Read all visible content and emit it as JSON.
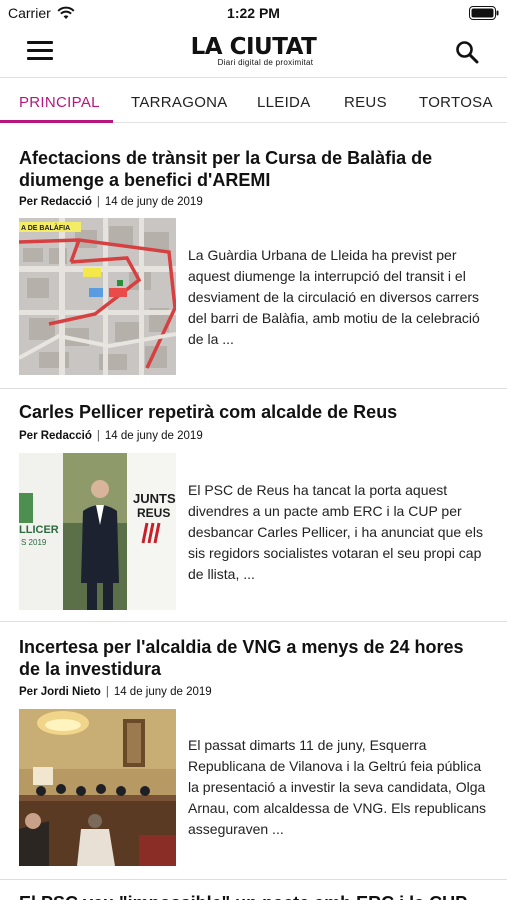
{
  "status_bar": {
    "carrier": "Carrier",
    "time": "1:22 PM",
    "icons": [
      "wifi-icon",
      "battery-icon"
    ]
  },
  "header": {
    "logo_title": "LA CIUTAT",
    "logo_subtitle": "Diari digital de proximitat",
    "icons": [
      "menu-icon",
      "search-icon"
    ]
  },
  "tabs": [
    {
      "label": "PRINCIPAL",
      "active": true
    },
    {
      "label": "TARRAGONA",
      "active": false
    },
    {
      "label": "LLEIDA",
      "active": false
    },
    {
      "label": "REUS",
      "active": false
    },
    {
      "label": "TORTOSA",
      "active": false
    }
  ],
  "colors": {
    "accent": "#b5177e",
    "text": "#111111",
    "divider": "#dedede"
  },
  "articles": [
    {
      "title": "Afectacions de trànsit per la Cursa de Balàfia de diumenge a benefici d'AREMI",
      "author": "Per Redacció",
      "date": "14 de juny de 2019",
      "thumb_label": "A DE BALÀFIA",
      "excerpt": "La Guàrdia Urbana de Lleida ha previst per aquest diumenge la interrupció del transit i el desviament de la circulació en diversos carrers del barri de Balàfia, amb motiu de la celebració de la ..."
    },
    {
      "title": "Carles Pellicer repetirà com alcalde de Reus",
      "author": "Per Redacció",
      "date": "14 de juny de 2019",
      "thumb_label_left": "LLICER",
      "thumb_label_left2": "S 2019",
      "thumb_label_right": "JUNTS",
      "thumb_label_right2": "REUS",
      "excerpt": "El PSC de Reus ha tancat la porta aquest divendres a un pacte amb ERC i la CUP per desbancar Carles Pellicer, i ha anunciat que els sis regidors socialistes votaran el seu propi cap de llista, ..."
    },
    {
      "title": "Incertesa per l'alcaldia de VNG a menys de 24 hores de la investidura",
      "author": "Per Jordi Nieto",
      "date": "14 de juny de 2019",
      "excerpt": "El passat dimarts 11 de juny, Esquerra Republicana de Vilanova i la Geltrú feia pública la presentació a investir la seva candidata, Olga Arnau, com alcaldessa de VNG. Els republicans asseguraven ..."
    },
    {
      "title": "El PSC veu \"impossible\" un pacte amb ERC i la CUP"
    }
  ]
}
